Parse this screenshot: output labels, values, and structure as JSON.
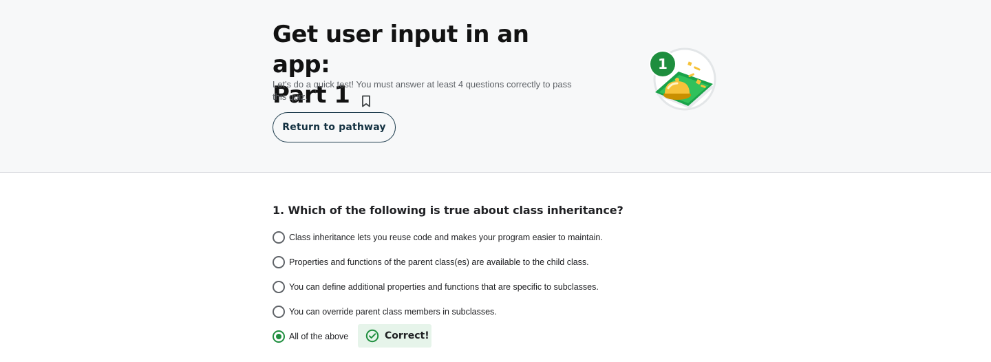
{
  "header": {
    "title_line1": "Get user input in an app:",
    "title_line2": "Part 1",
    "subtitle": "Let's do a quick test! You must answer at least 4 questions correctly to pass this quiz.",
    "return_label": "Return to pathway",
    "badge_number": "1",
    "badge_icon": "bell-badge-icon",
    "bookmark_icon": "bookmark-icon"
  },
  "quiz": {
    "question": "1. Which of the following is true about class inheritance?",
    "options": [
      {
        "label": "Class inheritance lets you reuse code and makes your program easier to maintain.",
        "selected": false
      },
      {
        "label": "Properties and functions of the parent class(es) are available to the child class.",
        "selected": false
      },
      {
        "label": "You can define additional properties and functions that are specific to subclasses.",
        "selected": false
      },
      {
        "label": "You can override parent class members in subclasses.",
        "selected": false
      },
      {
        "label": "All of the above",
        "selected": true
      }
    ],
    "feedback": "Correct!",
    "feedback_icon": "check-circle-icon"
  },
  "colors": {
    "correct_green": "#1e8e3e",
    "feedback_bg": "#e6f4ea",
    "header_bg": "#f7f8f9"
  }
}
